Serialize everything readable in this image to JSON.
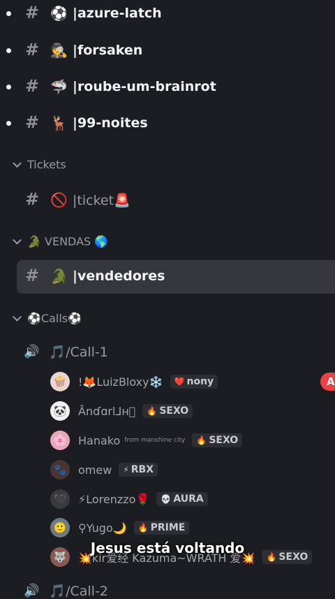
{
  "channels_top": [
    {
      "emoji": "⚽",
      "name": "|azure-latch"
    },
    {
      "emoji": "🕵️",
      "name": "|forsaken"
    },
    {
      "emoji": "🦈",
      "name": "|roube-um-brainrot"
    },
    {
      "emoji": "🦌",
      "name": "|99-noites"
    }
  ],
  "categories": {
    "tickets": "Tickets",
    "vendas": "🐊 VENDAS 🌎",
    "calls": "⚽Calls⚽"
  },
  "ticket_channel": {
    "emoji": "🚫",
    "name": "|ticket🚨"
  },
  "vendas_channel": {
    "emoji": "🐊",
    "name": "|vendedores"
  },
  "hash_symbol": "#",
  "voice_channels": {
    "call1": "🎵/Call-1",
    "call2": "🎵/Call-2"
  },
  "members": [
    {
      "avatar": "🍿",
      "name": "!🦊LuizBloxy❄️",
      "sub": "",
      "tag_icon": "❤️",
      "tag": "nony"
    },
    {
      "avatar": "🐼",
      "name": "Ȃnɗɑrl⅃ʜ⃠",
      "sub": "",
      "tag_icon": "🔥",
      "tag": "SEXO"
    },
    {
      "avatar": "🌸",
      "name": "Hanako",
      "sub": "from manshine city",
      "tag_icon": "🔥",
      "tag": "SEXO"
    },
    {
      "avatar": "🐾",
      "name": "omew",
      "sub": "",
      "tag_icon": "⚡",
      "tag": "RBX"
    },
    {
      "avatar": "🖤",
      "name": "⚡Lorenzzo🌹",
      "sub": "",
      "tag_icon": "💀",
      "tag": "AURA"
    },
    {
      "avatar": "🙂",
      "name": "⚲Yugo🌙",
      "sub": "",
      "tag_icon": "🔥",
      "tag": "PRIME"
    },
    {
      "avatar": "🐺",
      "name": "💥kir爱经 Kazuma~WRATH 爱💥",
      "sub": "",
      "tag_icon": "🔥",
      "tag": "SEXO"
    }
  ],
  "badge": "A",
  "caption": "Jesus está voltando",
  "colors": {
    "background": "#1c1d22",
    "selected": "#35373d",
    "badge": "#f23f43"
  }
}
